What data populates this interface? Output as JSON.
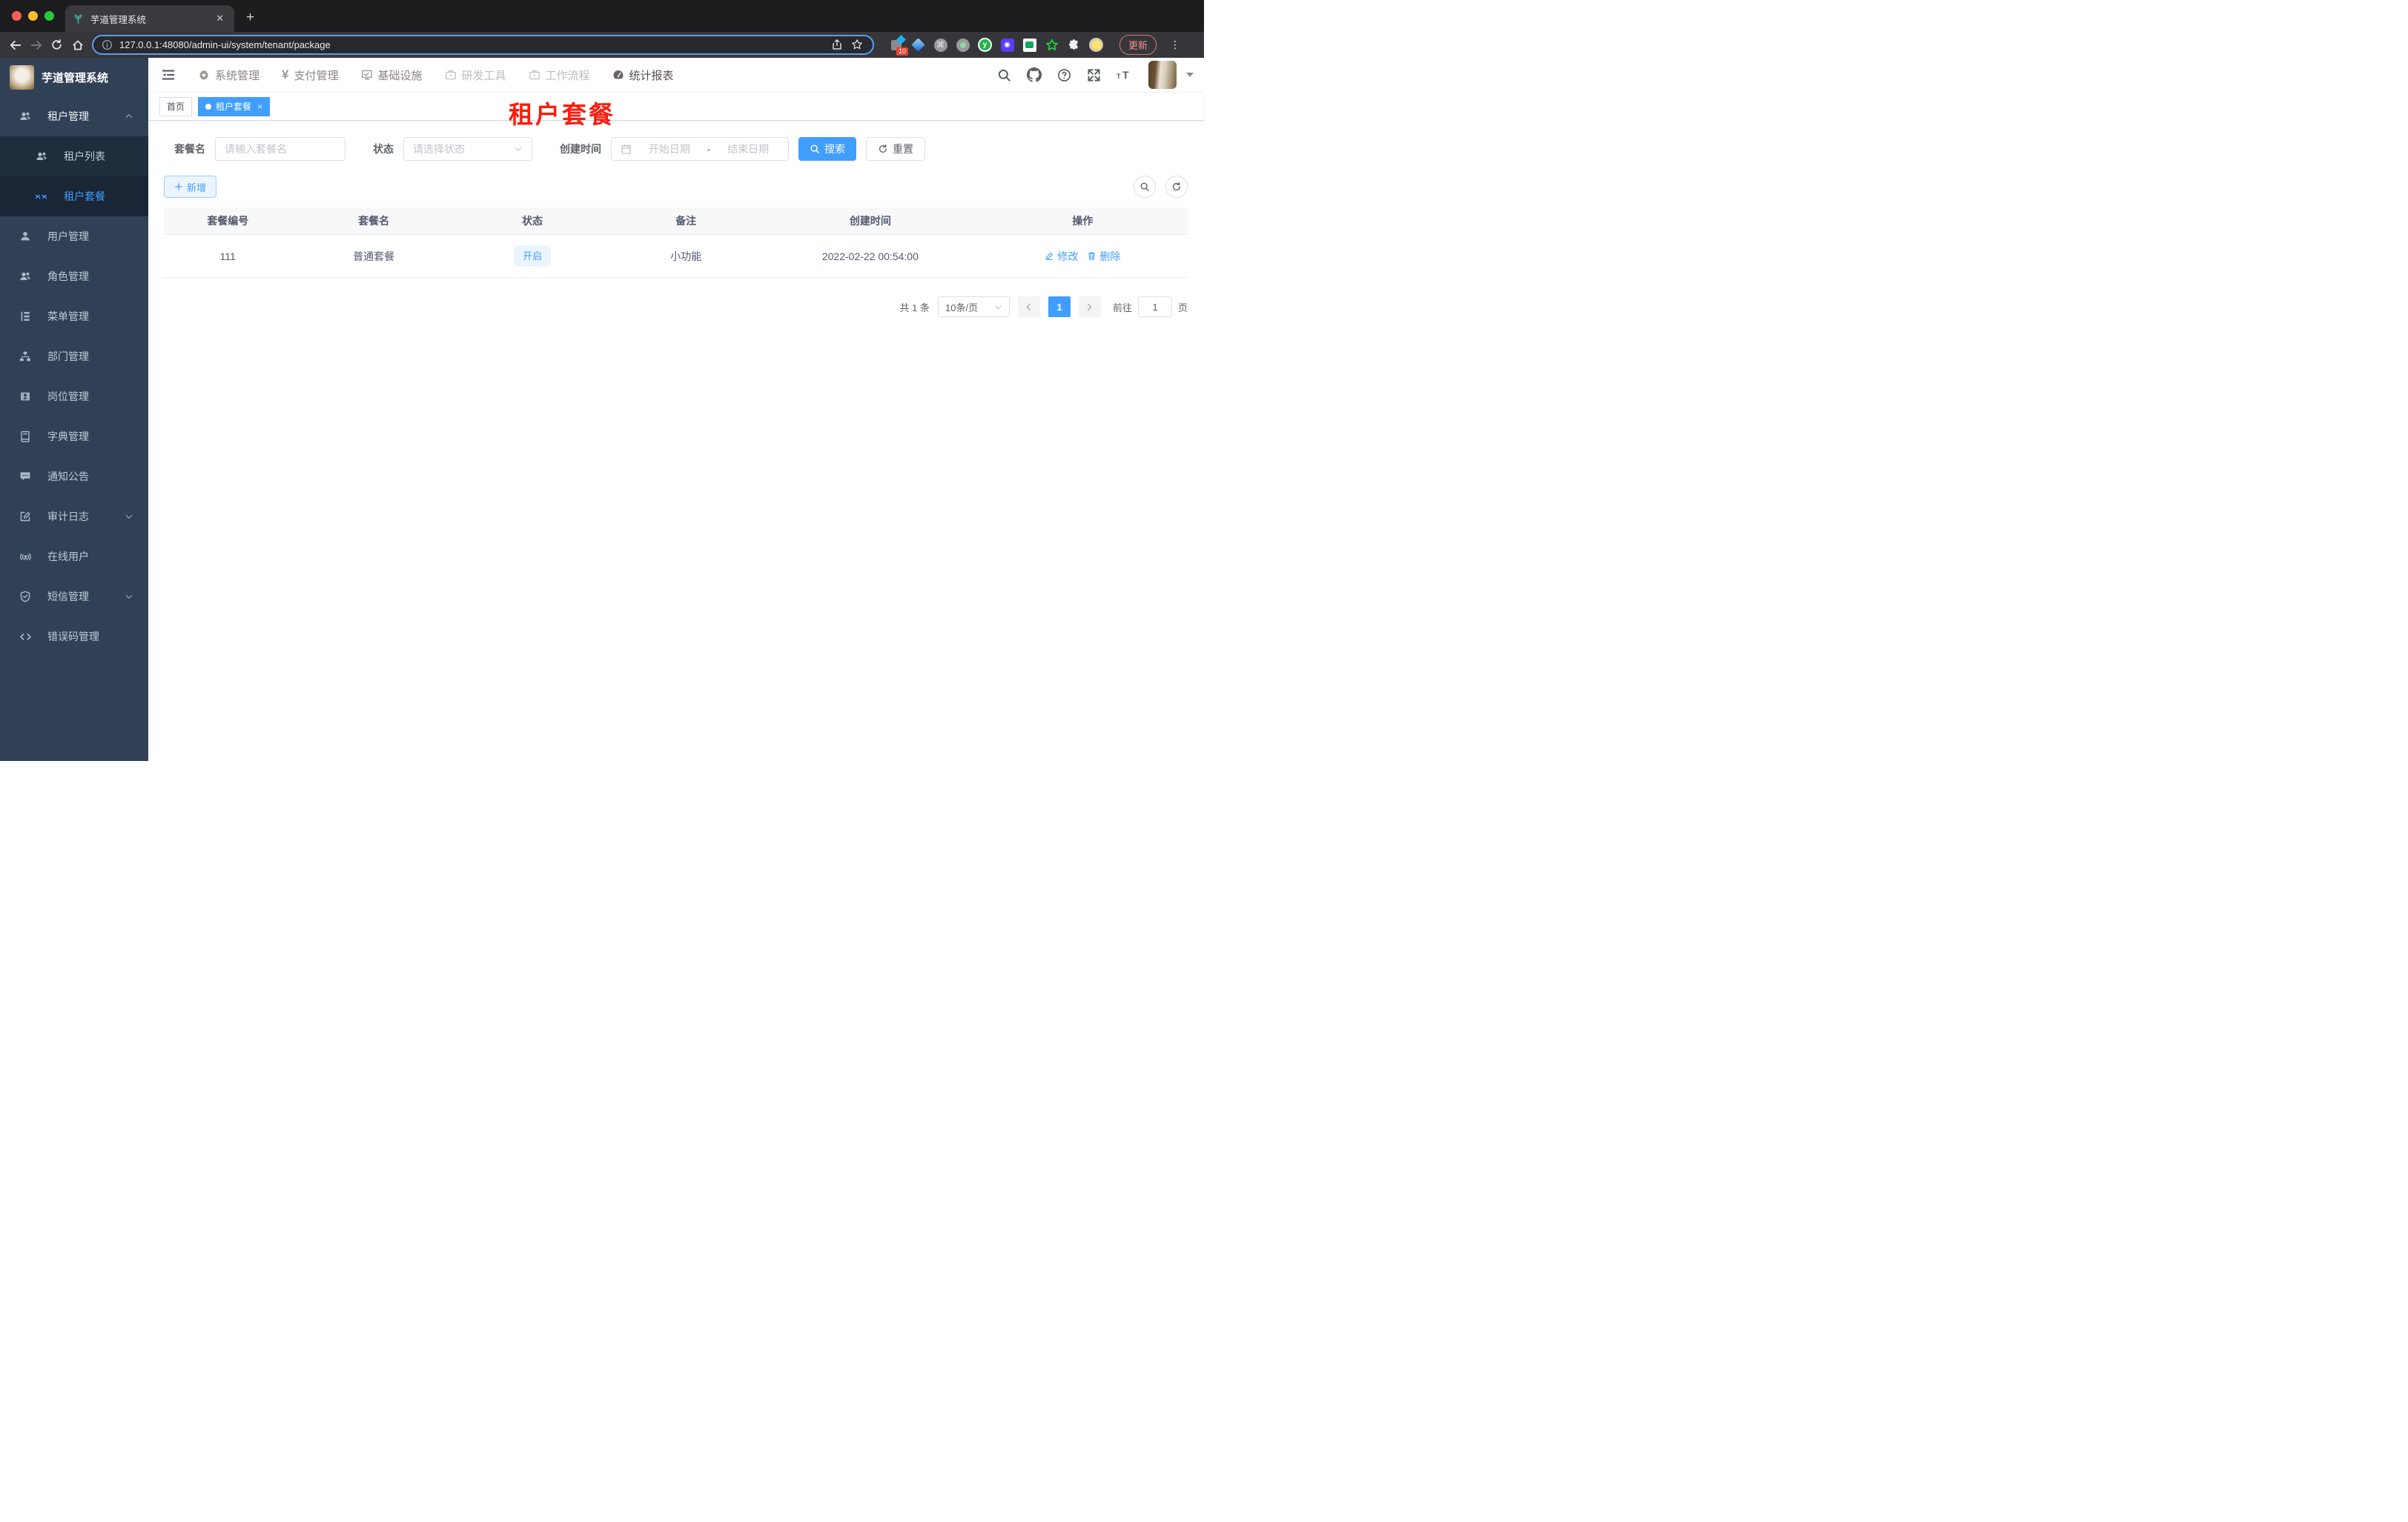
{
  "browser": {
    "tab_title": "芋道管理系统",
    "url": "127.0.0.1:48080/admin-ui/system/tenant/package",
    "update_label": "更新",
    "extension_badge": "10"
  },
  "topnav": {
    "items": [
      {
        "label": "系统管理",
        "icon": "gear-icon"
      },
      {
        "label": "支付管理",
        "icon": "yen-icon"
      },
      {
        "label": "基础设施",
        "icon": "monitor-icon"
      },
      {
        "label": "研发工具",
        "icon": "briefcase-icon"
      },
      {
        "label": "工作流程",
        "icon": "briefcase-icon"
      },
      {
        "label": "统计报表",
        "icon": "dashboard-icon"
      }
    ]
  },
  "sidebar": {
    "title": "芋道管理系统",
    "items": [
      {
        "label": "租户管理",
        "icon": "peoples-icon",
        "state": "expanded"
      },
      {
        "label": "租户列表",
        "icon": "peoples-icon"
      },
      {
        "label": "租户套餐",
        "icon": "package-icon",
        "state": "active"
      },
      {
        "label": "用户管理",
        "icon": "user-icon"
      },
      {
        "label": "角色管理",
        "icon": "peoples-icon"
      },
      {
        "label": "菜单管理",
        "icon": "tree-table-icon"
      },
      {
        "label": "部门管理",
        "icon": "org-tree-icon"
      },
      {
        "label": "岗位管理",
        "icon": "post-icon"
      },
      {
        "label": "字典管理",
        "icon": "dict-icon"
      },
      {
        "label": "通知公告",
        "icon": "message-icon"
      },
      {
        "label": "审计日志",
        "icon": "log-icon",
        "state": "collapsed"
      },
      {
        "label": "在线用户",
        "icon": "online-icon"
      },
      {
        "label": "短信管理",
        "icon": "shield-icon",
        "state": "collapsed"
      },
      {
        "label": "错误码管理",
        "icon": "code-icon"
      }
    ]
  },
  "tags": {
    "home": "首页",
    "active": "租户套餐"
  },
  "annotation": {
    "text": "租户套餐",
    "color": "#fb1c0e"
  },
  "filters": {
    "name_label": "套餐名",
    "name_placeholder": "请输入套餐名",
    "status_label": "状态",
    "status_placeholder": "请选择状态",
    "date_label": "创建时间",
    "date_start_placeholder": "开始日期",
    "date_separator": "-",
    "date_end_placeholder": "结束日期",
    "search_label": "搜索",
    "reset_label": "重置"
  },
  "toolbar": {
    "add_label": "新增"
  },
  "table": {
    "headers": [
      "套餐编号",
      "套餐名",
      "状态",
      "备注",
      "创建时间",
      "操作"
    ],
    "rows": [
      {
        "id": "111",
        "name": "普通套餐",
        "status": "开启",
        "remark": "小功能",
        "created": "2022-02-22 00:54:00"
      }
    ],
    "actions": {
      "edit": "修改",
      "delete": "删除"
    }
  },
  "pagination": {
    "total": "共 1 条",
    "page_size": "10条/页",
    "current_page": "1",
    "goto_label": "前往",
    "goto_value": "1",
    "page_unit": "页"
  },
  "colors": {
    "accent": "#409eff",
    "sidebar_bg": "#304156",
    "submenu_bg": "#1f2d3d",
    "status_tag_bg": "#ecf5ff",
    "status_tag_border": "#d9ecff",
    "tag_active_bg": "#409eff",
    "annotation_red": "#fb1c0e"
  }
}
